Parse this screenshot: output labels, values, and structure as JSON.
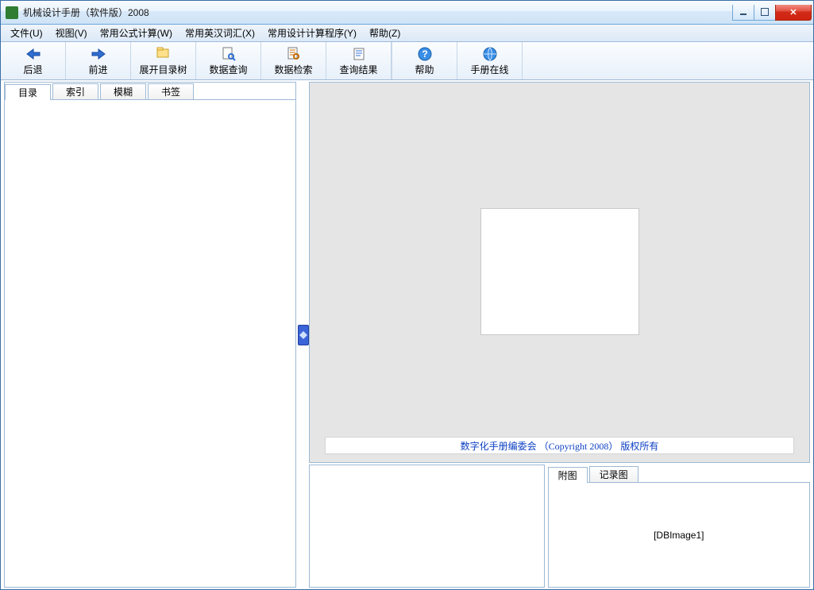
{
  "window": {
    "title": "机械设计手册（软件版）2008"
  },
  "menu": {
    "file": "文件(U)",
    "view": "视图(V)",
    "formula": "常用公式计算(W)",
    "dict": "常用英汉词汇(X)",
    "calc": "常用设计计算程序(Y)",
    "help": "帮助(Z)"
  },
  "toolbar": {
    "back": "后退",
    "forward": "前进",
    "expand_tree": "展开目录树",
    "data_query": "数据查询",
    "data_search": "数据检索",
    "query_result": "查询结果",
    "help": "帮助",
    "manual_online": "手册在线"
  },
  "left_tabs": {
    "toc": "目录",
    "index": "索引",
    "fuzzy": "模糊",
    "bookmark": "书签"
  },
  "content": {
    "copyright": "数字化手册编委会 （Copyright 2008） 版权所有"
  },
  "bottom_tabs": {
    "attach": "附图",
    "record": "记录图"
  },
  "dbimage": {
    "placeholder": "[DBImage1]"
  },
  "icons": {
    "back": "back-arrow-icon",
    "forward": "forward-arrow-icon",
    "expand": "folder-tree-icon",
    "query": "document-search-icon",
    "search": "document-find-icon",
    "result": "document-result-icon",
    "help": "help-icon",
    "online": "globe-icon"
  }
}
